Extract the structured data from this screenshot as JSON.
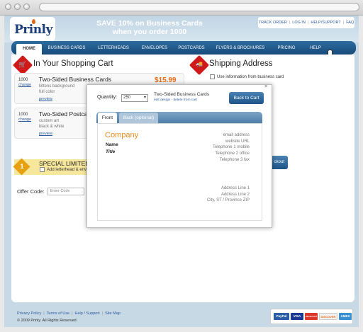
{
  "site": {
    "logo": "Prinly",
    "promo_line1": "SAVE 10% on Business Cards",
    "promo_line2": "when you order 1000",
    "toplinks": [
      "TRACK ORDER",
      "LOG IN",
      "HELP/SUPPORT",
      "FAQ"
    ]
  },
  "nav": {
    "items": [
      "HOME",
      "BUSINESS CARDS",
      "LETTERHEADS",
      "ENVELOPES",
      "POSTCARDS",
      "FLYERS & BROCHURES",
      "PRICING",
      "HELP"
    ],
    "active": "HOME"
  },
  "cart": {
    "heading": "In Your Shopping Cart",
    "items": [
      {
        "qty": "1000",
        "change": "change",
        "title": "Two-Sided Business Cards",
        "options": [
          "kittens background",
          "full color"
        ],
        "preview": "preview",
        "price": "$15.99"
      },
      {
        "qty": "1000",
        "change": "change",
        "title": "Two-Sided Postcard",
        "options": [
          "custom art",
          "black & white"
        ],
        "preview": "preview"
      }
    ],
    "special_title": "SPECIAL LIMITED",
    "special_badge": "1",
    "special_add": "Add letterhead & env",
    "checkout_label": "ckout",
    "offer_label": "Offer Code:",
    "offer_placeholder": "Enter Code"
  },
  "shipping": {
    "heading": "Shipping Address",
    "use_business_card": "Use information from business card"
  },
  "modal": {
    "close": "×",
    "qty_label": "Quantity:",
    "qty_value": "250",
    "product": "Two-Sided Business Cards",
    "edit_links": "edit design · delete from cart",
    "back_button": "Back to Cart",
    "tab_front": "Front",
    "tab_back": "Back (optional)",
    "preview": {
      "company": "Company",
      "name": "Name",
      "title": "Title",
      "contact": [
        "email address",
        "website URL",
        "Telephone 1 mobile",
        "Telephone 2 office",
        "Telephone 3 fax"
      ],
      "address": [
        "Address Line 1",
        "Address Line 2",
        "City, ST / Province ZIP"
      ]
    }
  },
  "footer": {
    "links": [
      "Privacy Policy",
      "Terms of Use",
      "Help / Support",
      "Site Map"
    ],
    "copyright": "© 2009 Prinly. All Rights Reserved",
    "payment_methods": [
      "PayPal",
      "VISA",
      "MasterCard",
      "DISCOVER",
      "AMEX"
    ]
  },
  "colors": {
    "brand_blue": "#1b3f78",
    "nav_blue": "#174a7a",
    "accent_orange": "#e86e19",
    "badge_red": "#d01919"
  }
}
